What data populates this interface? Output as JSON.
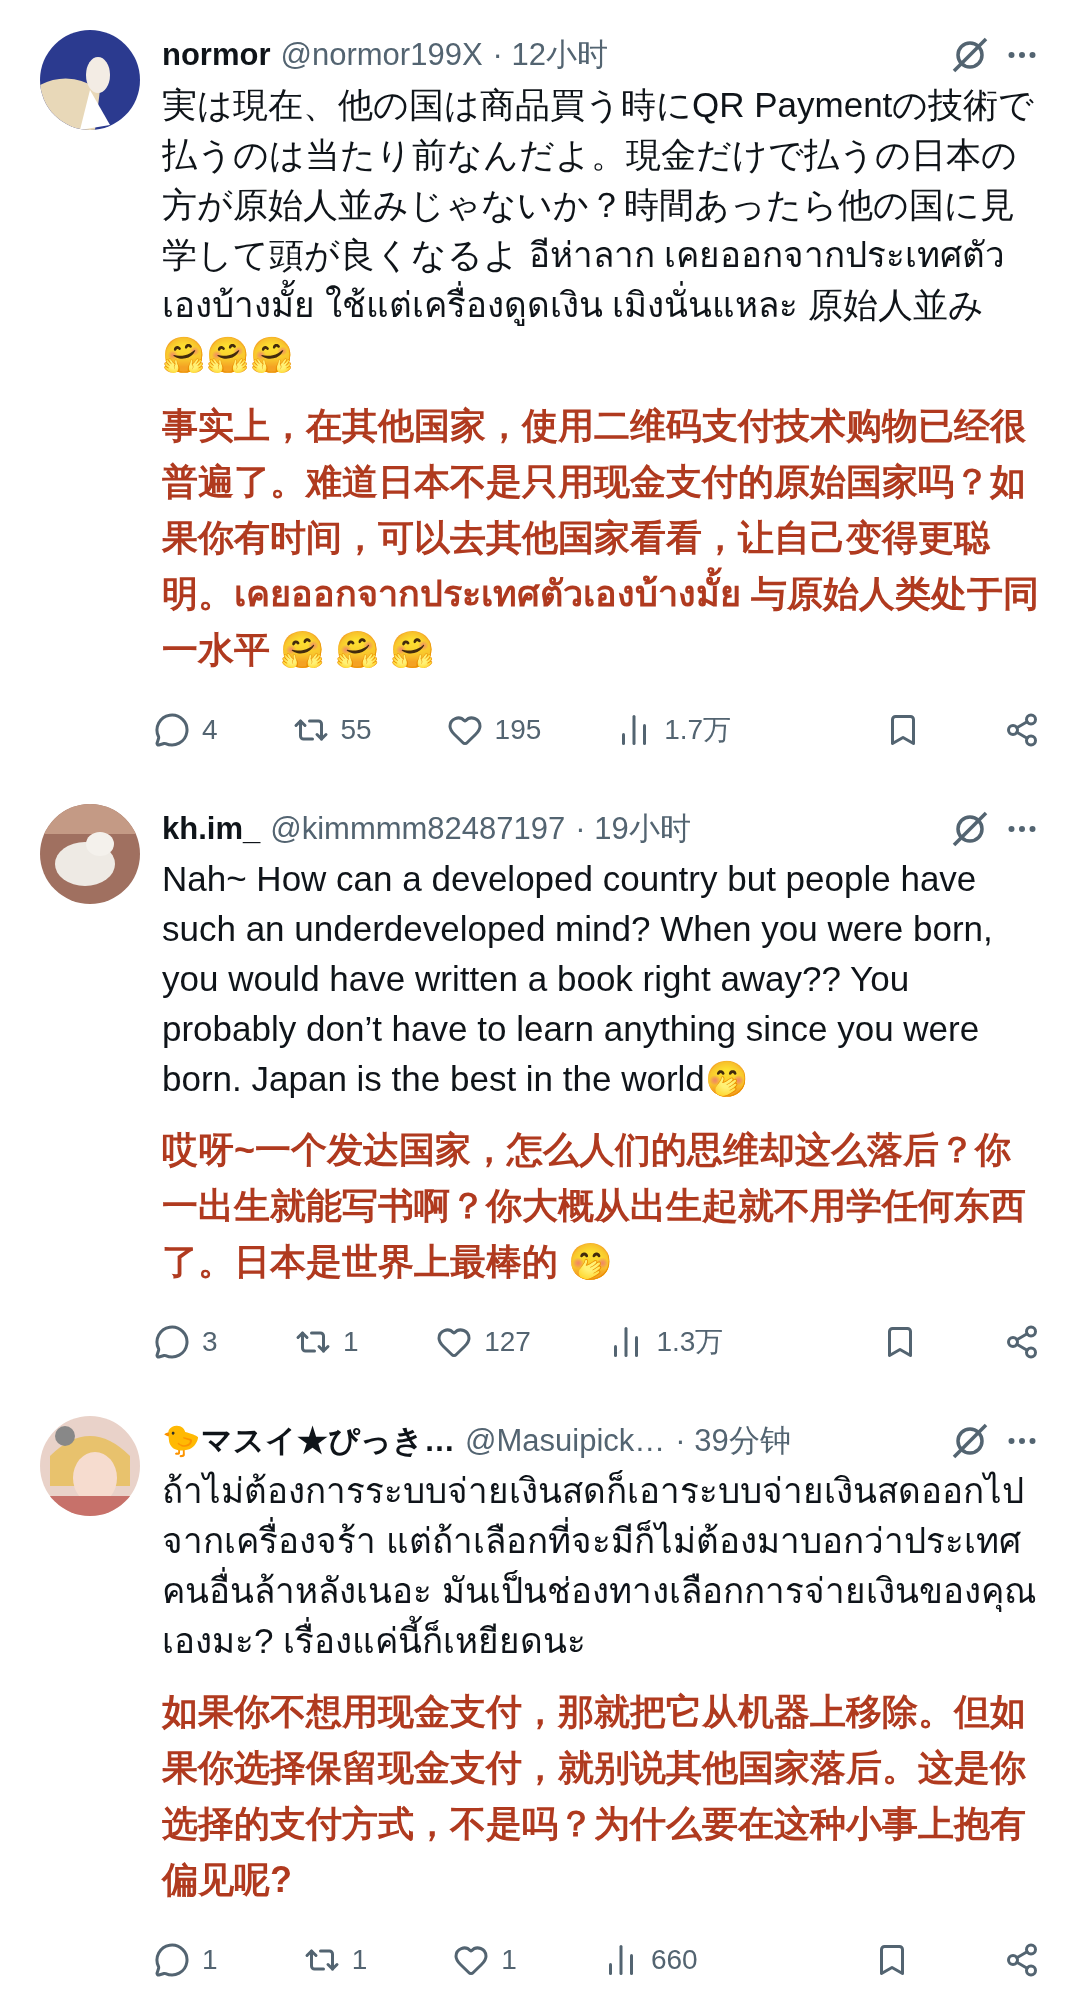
{
  "posts": [
    {
      "display_name": "normor",
      "handle": "@normor199X",
      "time": "· 12小时",
      "text": "実は現在、他の国は商品買う時にQR Paymentの技術で払うのは当たり前なんだよ。現金だけで払うの日本の方が原始人並みじゃないか？時間あったら他の国に見学して頭が良くなるよ อีห่าลาก เคยออกจากประเทศตัวเองบ้างมั้ย ใช้แต่เครื่องดูดเงิน เมิงนั่นแหละ 原始人並み\n🤗🤗🤗",
      "translation": "事实上，在其他国家，使用二维码支付技术购物已经很普遍了。难道日本不是只用现金支付的原始国家吗？如果你有时间，可以去其他国家看看，让自己变得更聪明。เคยออกจากประเทศตัวเองบ้างมั้ย 与原始人类处于同一水平 🤗 🤗 🤗",
      "replies": "4",
      "reposts": "55",
      "likes": "195",
      "views": "1.7万"
    },
    {
      "display_name": "kh.im_",
      "handle": "@kimmmm82487197",
      "time": "· 19小时",
      "text": "Nah~ How can a developed country but people have such an underdeveloped mind? When you were born, you would have written a book right away?? You probably don’t have to learn anything since you were born. Japan is the best in the world🤭",
      "translation": "哎呀~一个发达国家，怎么人们的思维却这么落后？你一出生就能写书啊？你大概从出生起就不用学任何东西了。日本是世界上最棒的 🤭",
      "replies": "3",
      "reposts": "1",
      "likes": "127",
      "views": "1.3万"
    },
    {
      "display_name": "🐤マスイ★ぴっき…",
      "handle": "@Masuipick…",
      "time": "· 39分钟",
      "text": "ถ้าไม่ต้องการระบบจ่ายเงินสดก็เอาระบบจ่ายเงินสดออกไปจากเครื่องจร้า แต่ถ้าเลือกที่จะมีก็ไม่ต้องมาบอกว่าประเทศคนอื่นล้าหลังเนอะ มันเป็นช่องทางเลือกการจ่ายเงินของคุณเองมะ? เรื่องแค่นี้ก็เหยียดนะ",
      "translation": "如果你不想用现金支付，那就把它从机器上移除。但如果你选择保留现金支付，就别说其他国家落后。这是你选择的支付方式，不是吗？为什么要在这种小事上抱有偏见呢?",
      "replies": "1",
      "reposts": "1",
      "likes": "1",
      "views": "660"
    }
  ]
}
